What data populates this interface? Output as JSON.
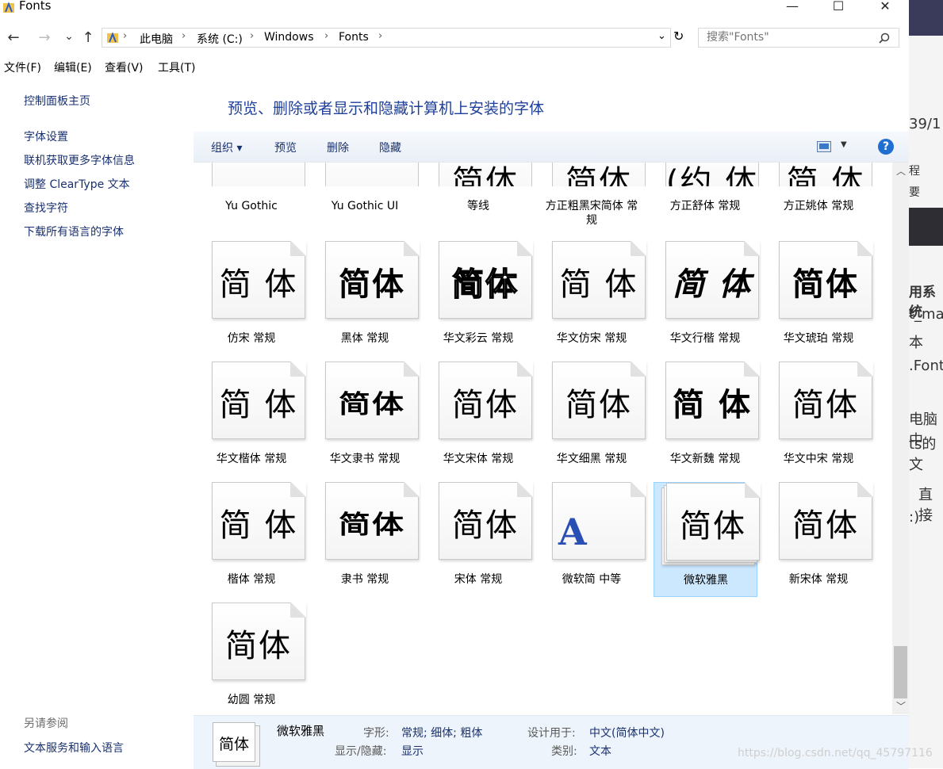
{
  "window": {
    "title": "Fonts",
    "minimize": "—",
    "maximize": "☐",
    "close": "✕"
  },
  "nav": {
    "back": "←",
    "forward": "→",
    "recent": "⌄",
    "up": "↑",
    "dropdown": "⌄",
    "refresh": "↻"
  },
  "address": {
    "crumbs": [
      "此电脑",
      "系统 (C:)",
      "Windows",
      "Fonts"
    ]
  },
  "search": {
    "placeholder": "搜索\"Fonts\""
  },
  "menu": [
    "文件(F)",
    "编辑(E)",
    "查看(V)",
    "工具(T)"
  ],
  "left": {
    "home": "控制面板主页",
    "links": [
      "字体设置",
      "联机获取更多字体信息",
      "调整 ClearType 文本",
      "查找字符",
      "下载所有语言的字体"
    ],
    "see_also": "另请参阅",
    "see_also_link": "文本服务和输入语言"
  },
  "main": {
    "title": "预览、删除或者显示和隐藏计算机上安装的字体"
  },
  "toolbar": {
    "organize": "组织 ▾",
    "preview": "预览",
    "delete": "删除",
    "hide": "隐藏",
    "help": "?"
  },
  "fonts_row0": [
    {
      "name": "Yu Gothic",
      "glyph": ""
    },
    {
      "name": "Yu Gothic UI",
      "glyph": ""
    },
    {
      "name": "等线",
      "glyph": "简体"
    },
    {
      "name": "方正粗黑宋简体 常规",
      "glyph": "简体"
    },
    {
      "name": "方正舒体 常规",
      "glyph": "(约 体"
    },
    {
      "name": "方正姚体 常规",
      "glyph": "简 体"
    }
  ],
  "fonts": [
    {
      "name": "仿宋 常规",
      "glyph": "简 体"
    },
    {
      "name": "黑体 常规",
      "glyph": "简体"
    },
    {
      "name": "华文彩云 常规",
      "glyph": "简体"
    },
    {
      "name": "华文仿宋 常规",
      "glyph": "简 体"
    },
    {
      "name": "华文行楷 常规",
      "glyph": "简 体"
    },
    {
      "name": "华文琥珀 常规",
      "glyph": "简体"
    },
    {
      "name": "华文楷体 常规",
      "glyph": "简 体"
    },
    {
      "name": "华文隶书 常规",
      "glyph": "简体"
    },
    {
      "name": "华文宋体 常规",
      "glyph": "简体"
    },
    {
      "name": "华文细黑 常规",
      "glyph": "简体"
    },
    {
      "name": "华文新魏 常规",
      "glyph": "简 体"
    },
    {
      "name": "华文中宋 常规",
      "glyph": "简体"
    },
    {
      "name": "楷体 常规",
      "glyph": "简 体"
    },
    {
      "name": "隶书 常规",
      "glyph": "简体"
    },
    {
      "name": "宋体 常规",
      "glyph": "简体"
    },
    {
      "name": "微软简 中等",
      "glyph": "A"
    },
    {
      "name": "微软雅黑",
      "glyph": "简体"
    },
    {
      "name": "新宋体 常规",
      "glyph": "简体"
    },
    {
      "name": "幼圆 常规",
      "glyph": "简体"
    }
  ],
  "details": {
    "name": "微软雅黑",
    "glyph": "简体",
    "style_label": "字形:",
    "style_value": "常规; 细体; 粗体",
    "show_label": "显示/隐藏:",
    "show_value": "显示",
    "design_label": "设计用于:",
    "design_value": "中文(简体中文)",
    "category_label": "类别:",
    "category_value": "文本"
  },
  "right_fragment": [
    "39/1",
    "程",
    "要",
    "用系统",
    "t_ma",
    "本",
    ".Font",
    "电脑中",
    "ts的文",
    "直接",
    ":)"
  ],
  "watermark": "https://blog.csdn.net/qq_45797116"
}
